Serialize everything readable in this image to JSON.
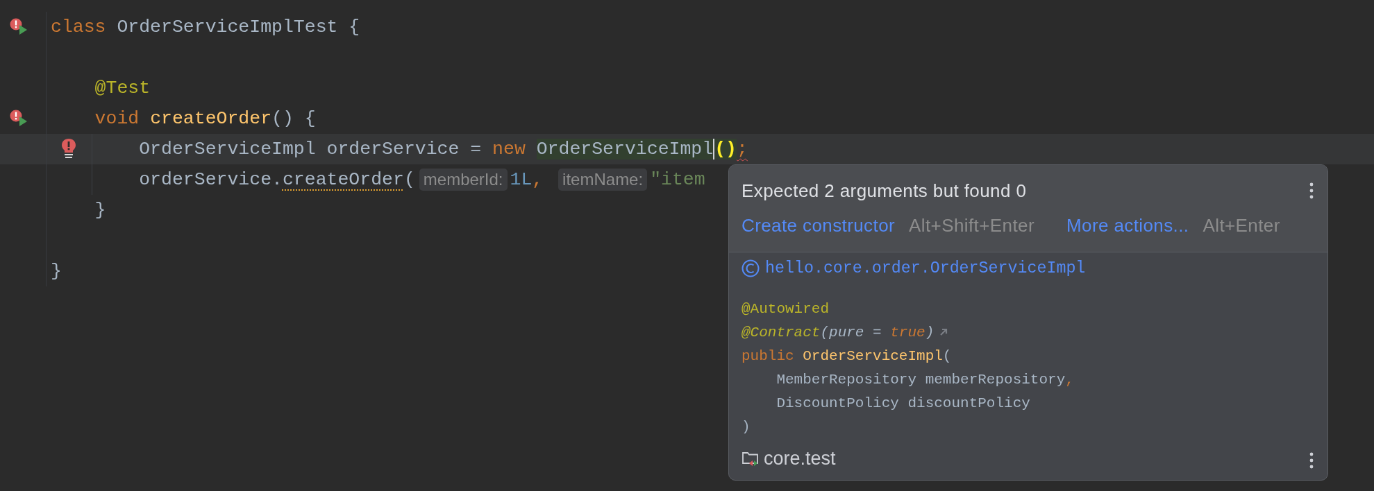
{
  "editor": {
    "lines": [
      {
        "gutter": {
          "kind": "error-run"
        },
        "current": false,
        "tokens": [
          {
            "kind": "keyword",
            "text": "class"
          },
          {
            "kind": "space"
          },
          {
            "kind": "class-name",
            "text": "OrderServiceImplTest"
          },
          {
            "kind": "space"
          },
          {
            "kind": "plain",
            "text": "{"
          }
        ],
        "children": [
          {
            "current": false
          },
          {
            "current": false,
            "tokens": [
              {
                "kind": "annotation",
                "text": "@Test"
              }
            ]
          },
          {
            "gutter": {
              "kind": "error-run"
            },
            "current": false,
            "tokens": [
              {
                "kind": "keyword",
                "text": "void"
              },
              {
                "kind": "space"
              },
              {
                "kind": "method",
                "text": "createOrder"
              },
              {
                "kind": "plain",
                "text": "() {"
              }
            ],
            "children": [
              {
                "gutter": {
                  "kind": "error-bulb"
                },
                "current": true,
                "tokens": [
                  {
                    "kind": "plain",
                    "text": "OrderServiceImpl orderService ="
                  },
                  {
                    "kind": "space"
                  },
                  {
                    "kind": "keyword",
                    "text": "new"
                  },
                  {
                    "kind": "space"
                  },
                  {
                    "kind": "usage",
                    "text": "OrderServiceImpl"
                  },
                  {
                    "kind": "caret"
                  },
                  {
                    "kind": "brace-match",
                    "text": "()"
                  },
                  {
                    "kind": "error-punct",
                    "text": ";"
                  }
                ]
              },
              {
                "current": false,
                "tokens": [
                  {
                    "kind": "plain",
                    "text": "orderService."
                  },
                  {
                    "kind": "method-warning",
                    "text": "createOrder"
                  },
                  {
                    "kind": "plain",
                    "text": "("
                  },
                  {
                    "kind": "hint",
                    "text": "memberId:"
                  },
                  {
                    "kind": "number",
                    "text": "1L"
                  },
                  {
                    "kind": "keyword",
                    "text": ","
                  },
                  {
                    "kind": "space"
                  },
                  {
                    "kind": "hint",
                    "text": "itemName:"
                  },
                  {
                    "kind": "string",
                    "text": "\"item"
                  }
                ]
              }
            ]
          },
          {
            "current": false,
            "tokens": [
              {
                "kind": "plain",
                "text": "}"
              }
            ]
          },
          {
            "current": false
          }
        ]
      },
      {
        "current": false,
        "tokens": [
          {
            "kind": "plain",
            "text": "}"
          }
        ]
      }
    ]
  },
  "popup": {
    "message": "Expected 2 arguments but found 0",
    "actions": [
      {
        "label": "Create constructor",
        "shortcut": "Alt+Shift+Enter"
      },
      {
        "label": "More actions...",
        "shortcut": "Alt+Enter"
      }
    ],
    "declaration": {
      "name": "hello.core.order.OrderServiceImpl",
      "lines": [
        {
          "tokens": [
            {
              "kind": "annotation",
              "text": "@Autowired"
            }
          ]
        },
        {
          "tokens": [
            {
              "kind": "annotation-italic",
              "text": "@Contract"
            },
            {
              "kind": "plain-italic",
              "text": "(pure ="
            },
            {
              "kind": "space"
            },
            {
              "kind": "keyword-italic",
              "text": "true"
            },
            {
              "kind": "plain-italic",
              "text": ")"
            },
            {
              "kind": "link-icon"
            }
          ]
        },
        {
          "tokens": [
            {
              "kind": "keyword",
              "text": "public"
            },
            {
              "kind": "space"
            },
            {
              "kind": "method",
              "text": "OrderServiceImpl"
            },
            {
              "kind": "plain",
              "text": "("
            }
          ],
          "children": [
            {
              "tokens": [
                {
                  "kind": "type",
                  "text": "MemberRepository"
                },
                {
                  "kind": "space"
                },
                {
                  "kind": "plain",
                  "text": "memberRepository"
                },
                {
                  "kind": "keyword",
                  "text": ","
                }
              ]
            },
            {
              "tokens": [
                {
                  "kind": "type",
                  "text": "DiscountPolicy"
                },
                {
                  "kind": "space"
                },
                {
                  "kind": "plain",
                  "text": "discountPolicy"
                }
              ]
            }
          ]
        },
        {
          "tokens": [
            {
              "kind": "plain",
              "text": ")"
            }
          ]
        }
      ]
    },
    "module": "core.test"
  }
}
